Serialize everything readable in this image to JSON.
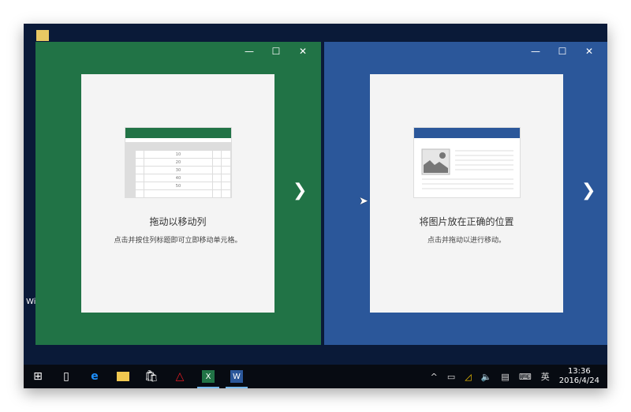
{
  "windows": [
    {
      "app": "Excel",
      "accent": "#217346",
      "title": "拖动以移动列",
      "subtitle": "点击并按住列标题即可立即移动单元格。",
      "grid_values": [
        "10",
        "20",
        "30",
        "40",
        "50"
      ]
    },
    {
      "app": "Word",
      "accent": "#2b579a",
      "title": "将图片放在正确的位置",
      "subtitle": "点击并拖动以进行移动。"
    }
  ],
  "window_controls": {
    "minimize": "—",
    "maximize": "☐",
    "close": "✕"
  },
  "desktop": {
    "icon_label": "Wi\n设"
  },
  "taskbar": {
    "ime": "英",
    "time": "13:36",
    "date": "2016/4/24"
  }
}
